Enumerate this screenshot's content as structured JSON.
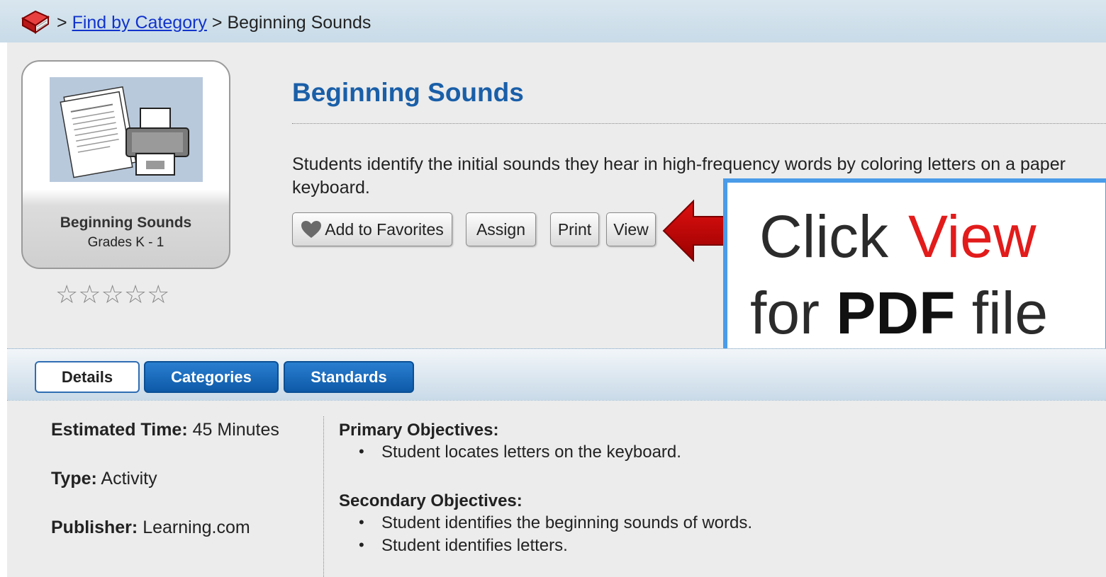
{
  "breadcrumb": {
    "sep1": ">",
    "link": "Find by Category",
    "sep2": ">",
    "current": "Beginning Sounds"
  },
  "tile": {
    "title": "Beginning Sounds",
    "grades": "Grades K - 1",
    "rating_stars": "☆☆☆☆☆"
  },
  "main": {
    "title": "Beginning Sounds",
    "description": "Students identify the initial sounds they hear in high-frequency words by coloring letters on a paper keyboard."
  },
  "actions": {
    "favorites": "Add to Favorites",
    "assign": "Assign",
    "print": "Print",
    "view": "View"
  },
  "callout": {
    "click": "Click",
    "view": "View",
    "for": "for",
    "pdf": "PDF",
    "file": "file"
  },
  "tabs": {
    "details": "Details",
    "categories": "Categories",
    "standards": "Standards"
  },
  "details": {
    "time_label": "Estimated Time:",
    "time_value": "45 Minutes",
    "type_label": "Type:",
    "type_value": "Activity",
    "publisher_label": "Publisher:",
    "publisher_value": "Learning.com"
  },
  "objectives": {
    "primary_heading": "Primary Objectives:",
    "primary": [
      "Student locates letters on the keyboard."
    ],
    "secondary_heading": "Secondary Objectives:",
    "secondary": [
      "Student identifies the beginning sounds of words.",
      "Student identifies letters."
    ]
  },
  "colors": {
    "title_blue": "#1a5fa8",
    "tab_blue": "#0d5aa8",
    "callout_border": "#4a9be8",
    "callout_red": "#e21b1b",
    "arrow_red": "#cc0000"
  }
}
